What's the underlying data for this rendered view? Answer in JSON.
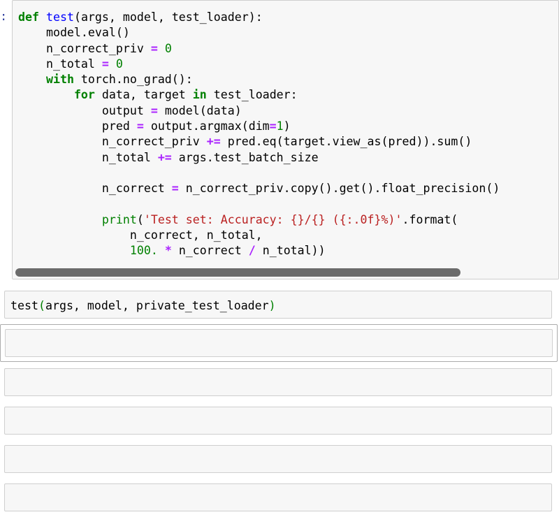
{
  "cells": {
    "cell1": {
      "prompt": ":",
      "lines": [
        "def test(args, model, test_loader):",
        "    model.eval()",
        "    n_correct_priv = 0",
        "    n_total = 0",
        "    with torch.no_grad():",
        "        for data, target in test_loader:",
        "            output = model(data)",
        "            pred = output.argmax(dim=1)",
        "            n_correct_priv += pred.eq(target.view_as(pred)).sum()",
        "            n_total += args.test_batch_size",
        "",
        "            n_correct = n_correct_priv.copy().get().float_precision()",
        "",
        "            print('Test set: Accuracy: {}/{} ({:.0f}%)'.format(",
        "                n_correct, n_total,",
        "                100. * n_correct / n_total))"
      ]
    },
    "cell2": {
      "code": "test(args, model, private_test_loader)"
    },
    "empty_cells": 5,
    "horizontal_scrollbar": {
      "thumb_fraction": 0.82
    }
  }
}
